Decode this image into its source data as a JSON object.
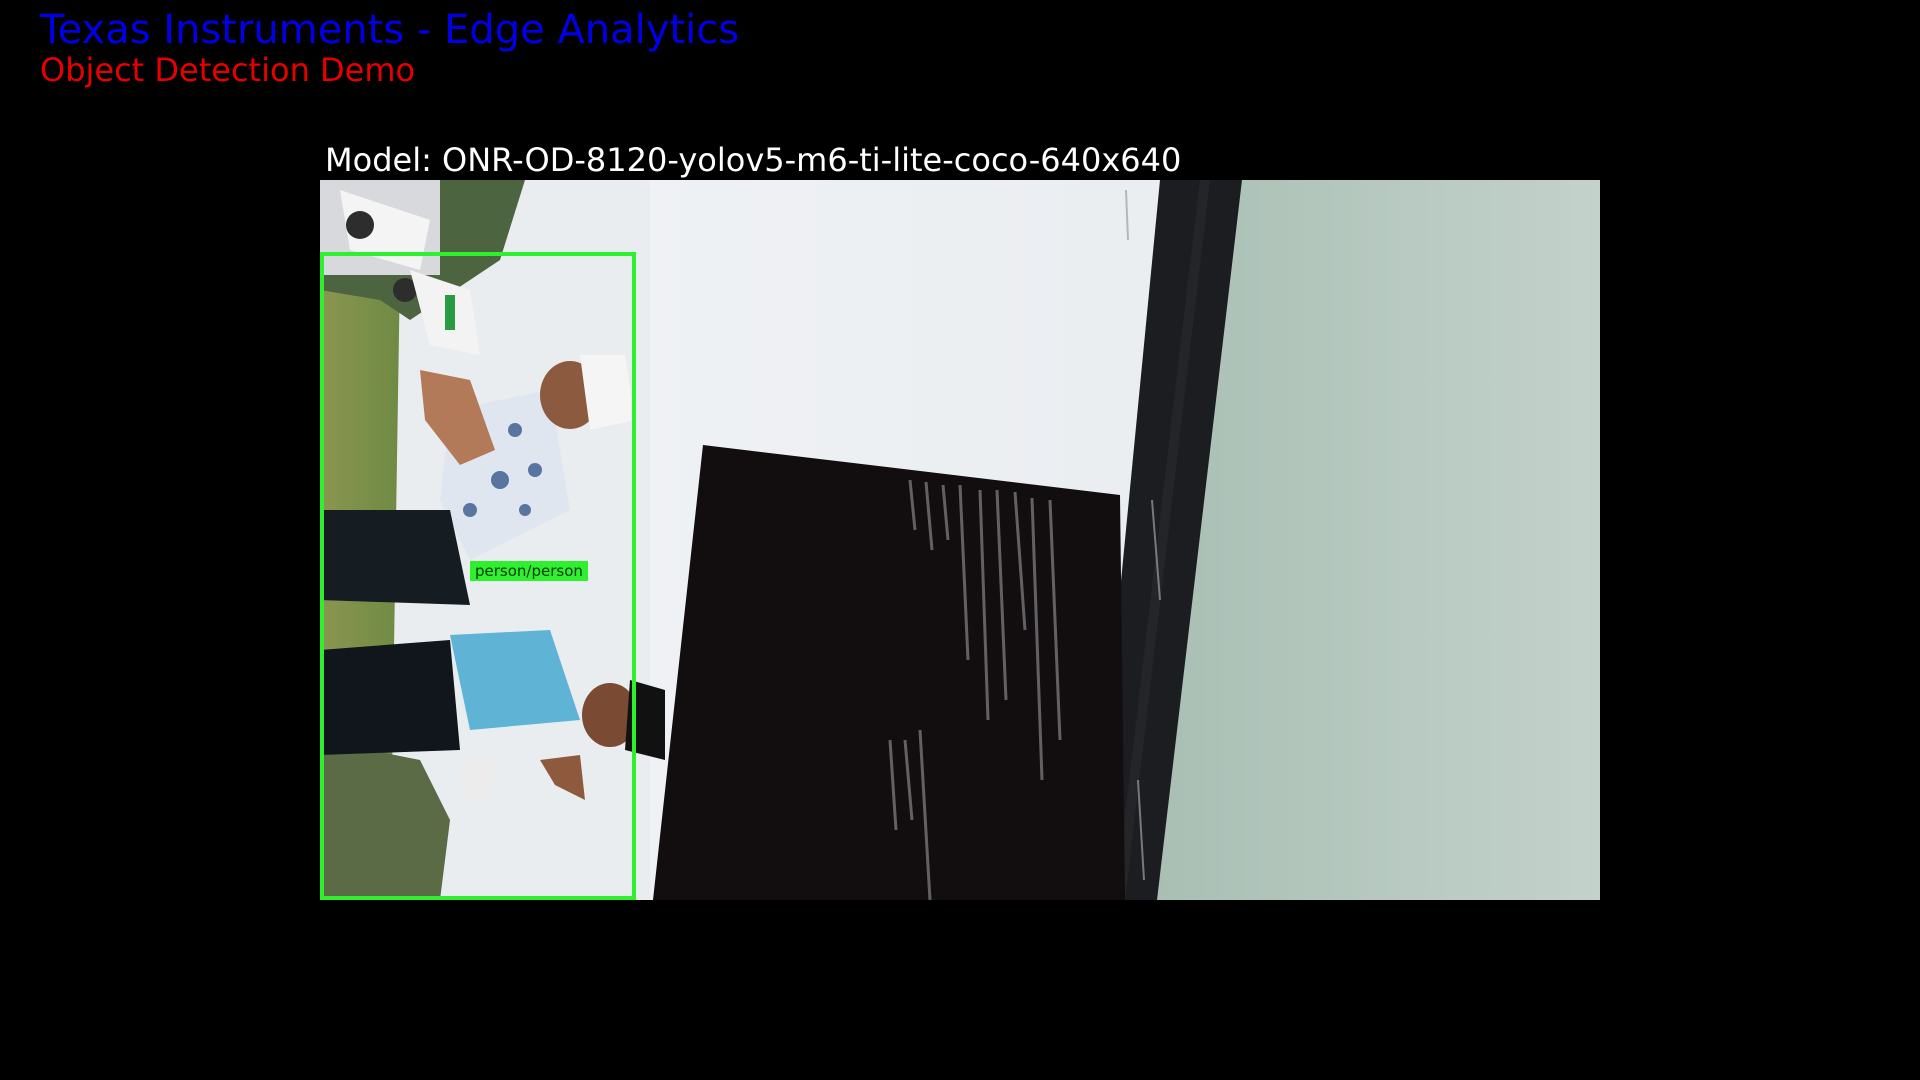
{
  "header": {
    "title": "Texas Instruments - Edge Analytics",
    "subtitle": "Object Detection Demo"
  },
  "model": {
    "label": "Model: ONR-OD-8120-yolov5-m6-ti-lite-coco-640x640"
  },
  "detections": [
    {
      "label": "person/person"
    }
  ],
  "colors": {
    "background": "#000000",
    "title": "#0000e6",
    "subtitle": "#e60000",
    "model_text": "#ffffff",
    "detection": "#2ef02e"
  }
}
